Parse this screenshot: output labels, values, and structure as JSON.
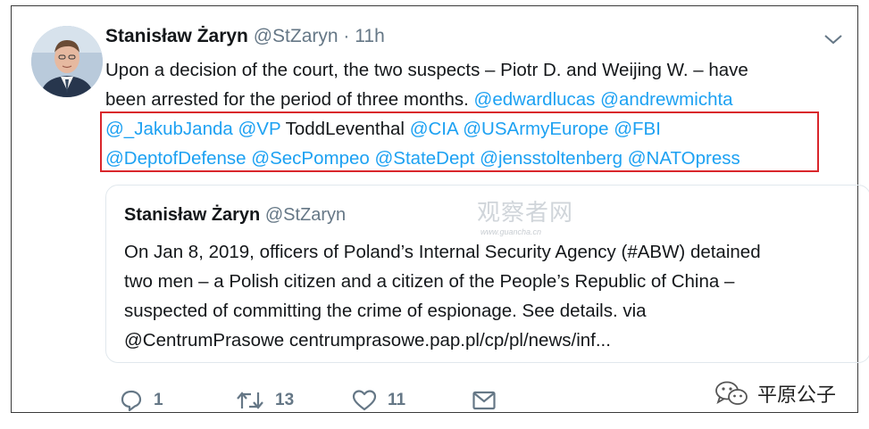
{
  "tweet": {
    "author_name": "Stanisław Żaryn",
    "author_handle": "@StZaryn",
    "separator": "·",
    "time": "11h",
    "line1": "Upon a decision of the court, the two suspects – Piotr D. and Weijing W. – have",
    "line2_text": "been arrested for the period of three months.",
    "line2_mentions": [
      "@edwardlucas",
      "@andrewmichta"
    ],
    "line3_mentions_a": [
      "@_JakubJanda",
      "@VP"
    ],
    "line3_plain": "ToddLeventhal",
    "line3_mentions_b": [
      "@CIA",
      "@USArmyEurope",
      "@FBI"
    ],
    "line4_mentions": [
      "@DeptofDefense",
      "@SecPompeo",
      "@StateDept",
      "@jensstoltenberg",
      "@NATOpress"
    ]
  },
  "quoted": {
    "author_name": "Stanisław Żaryn",
    "author_handle": "@StZaryn",
    "lines": [
      "On Jan 8, 2019, officers of Poland’s Internal Security Agency (#ABW) detained",
      "two men – a Polish citizen and a citizen of the People’s Republic of China –",
      "suspected of committing the crime of espionage. See details. via",
      "@CentrumPrasowe centrumprasowe.pap.pl/cp/pl/news/inf..."
    ]
  },
  "watermark": {
    "text": "观察者网",
    "url": "www.guancha.cn"
  },
  "actions": {
    "reply_count": "1",
    "retweet_count": "13",
    "like_count": "11"
  },
  "brand": {
    "text": "平原公子"
  },
  "colors": {
    "mention": "#1da1f2",
    "highlight_box": "#d9262b",
    "muted": "#657786"
  }
}
